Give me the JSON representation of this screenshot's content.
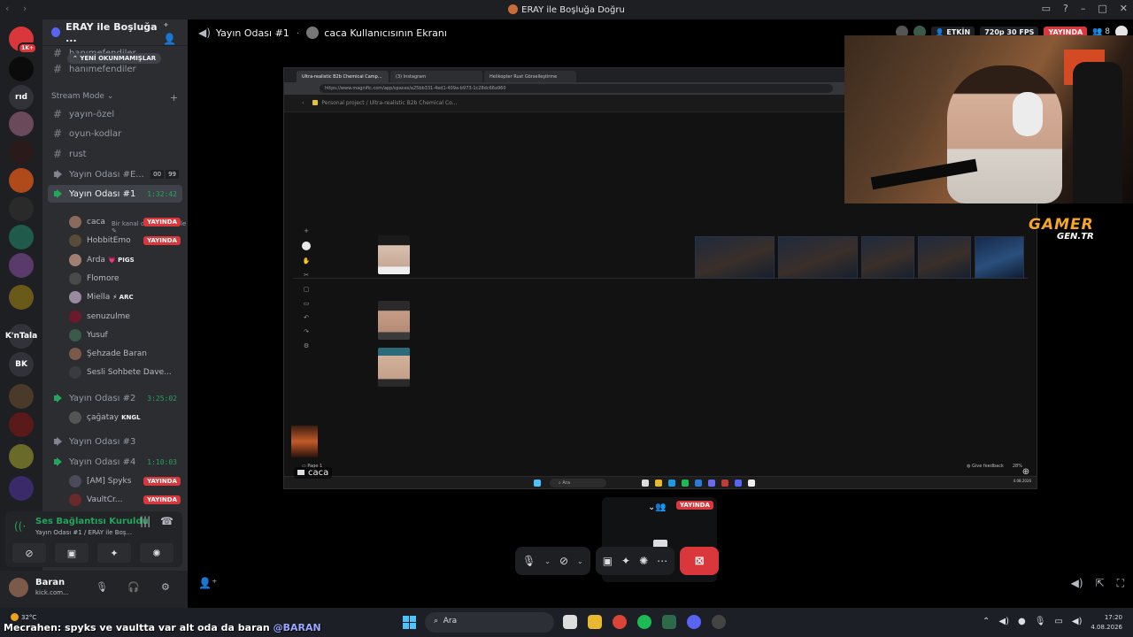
{
  "window": {
    "title": "ERAY ile Boşluğa Doğru"
  },
  "server": {
    "name": "ERAY ile Boşluğa ...",
    "new_unread": "YENİ OKUNMAMIŞLAR"
  },
  "guilds": [
    {
      "label": "1K+",
      "color": "#da373c"
    },
    {
      "label": "",
      "color": "#0b0b0b"
    },
    {
      "label": "rıd",
      "color": "#313338"
    },
    {
      "label": "",
      "color": "#6a4a5a"
    },
    {
      "label": "",
      "color": "#2a1a1a"
    },
    {
      "label": "",
      "color": "#b04a1a"
    },
    {
      "label": "",
      "color": "#2a2a2a"
    },
    {
      "label": "",
      "color": "#1f5a4a"
    },
    {
      "label": "",
      "color": "#5a3a6a"
    },
    {
      "label": "",
      "color": "#6a5a1a"
    },
    {
      "label": "K'nTala",
      "color": "#313338"
    },
    {
      "label": "BK",
      "color": "#313338"
    },
    {
      "label": "",
      "color": "#4a3a2a"
    },
    {
      "label": "",
      "color": "#5a1a1a"
    },
    {
      "label": "",
      "color": "#6a6a2a"
    },
    {
      "label": "",
      "color": "#3a2a6a"
    }
  ],
  "channels": {
    "top1": "hanımefendiler",
    "top2": "hanımefendiler",
    "section": "Stream Mode",
    "text": [
      "yayın-özel",
      "oyun-kodlar",
      "rust"
    ],
    "voice_e": {
      "name": "Yayın Odası #E...",
      "c1": "00",
      "c2": "99"
    },
    "voice1": {
      "name": "Yayın Odası #1",
      "time": "1:32:42",
      "status": "Bir kanal durumu belirle"
    },
    "voice2": {
      "name": "Yayın Odası #2",
      "time": "3:25:02"
    },
    "voice3": {
      "name": "Yayın Odası #3"
    },
    "voice4": {
      "name": "Yayın Odası #4",
      "time": "1:10:03"
    }
  },
  "members1": [
    {
      "name": "caca",
      "live": "YAYINDA",
      "color": "#8a6a5a"
    },
    {
      "name": "HobbitEmo",
      "live": "YAYINDA",
      "color": "#5a4a3a"
    },
    {
      "name": "Arda",
      "tag": "💗 PIGS",
      "color": "#a08070"
    },
    {
      "name": "Flomore",
      "color": "#4a4a4a"
    },
    {
      "name": "Miella",
      "tag": "⚡ ARC",
      "color": "#9a8aa0"
    },
    {
      "name": "senuzulme",
      "color": "#6a1a2a"
    },
    {
      "name": "Yusuf",
      "color": "#3a5a4a"
    },
    {
      "name": "Şehzade Baran",
      "color": "#7b5a4a"
    },
    {
      "name": "Sesli Sohbete Dave...",
      "color": "#3a3b40"
    }
  ],
  "members2": [
    {
      "name": "çağatay",
      "tag": "KNGL",
      "color": "#555"
    }
  ],
  "members4": [
    {
      "name": "[AM] Spyks",
      "live": "YAYINDA",
      "color": "#4a4a5a"
    },
    {
      "name": "VaultCr...",
      "live": "YAYINDA",
      "color": "#6a2a2a"
    }
  ],
  "voice": {
    "title": "Ses Bağlantısı Kuruldu",
    "sub": "Yayın Odası #1 / ERAY ile Boş..."
  },
  "user": {
    "name": "Baran",
    "status": "kick.com..."
  },
  "stage": {
    "channel": "Yayın Odası #1",
    "screen_title": "caca Kullanıcısının Ekranı",
    "active": "ETKİN",
    "quality": "720p 30 FPS",
    "live": "YAYINDA",
    "viewers": "8",
    "nameplate": "caca"
  },
  "shared": {
    "tabs": [
      "Ultra-realistic B2b Chemical Camp...",
      "(3) Instagram",
      "Helikopter Rust Görselleştirme"
    ],
    "url": "https://www.magnific.com/app/spaces/a25bb331-4ed1-409a-b973-1c28dc66a960",
    "crumb1": "Personal project",
    "crumb2": "Ultra-realistic B2b Chemical Co...",
    "page": "Page 1",
    "feedback": "Give feedback",
    "zoom": "28%",
    "search": "Ara",
    "date": "4.08.2026"
  },
  "overlay": {
    "line1a": "GAMER",
    "line1b": "",
    "line2": "GEN.TR"
  },
  "tile": {
    "name": "caca",
    "live": "YAYINDA"
  },
  "taskbar": {
    "temp": "32°C",
    "chat_user": "Mecrahen",
    "chat_msg": ": spyks ve vaultta var alt oda da baran ",
    "chat_mention": "@BARAN",
    "search": "Ara",
    "time": "17:20",
    "date": "4.08.2026"
  },
  "colors": {
    "accent": "#5865f2",
    "live": "#da373c",
    "online": "#23a55a"
  }
}
